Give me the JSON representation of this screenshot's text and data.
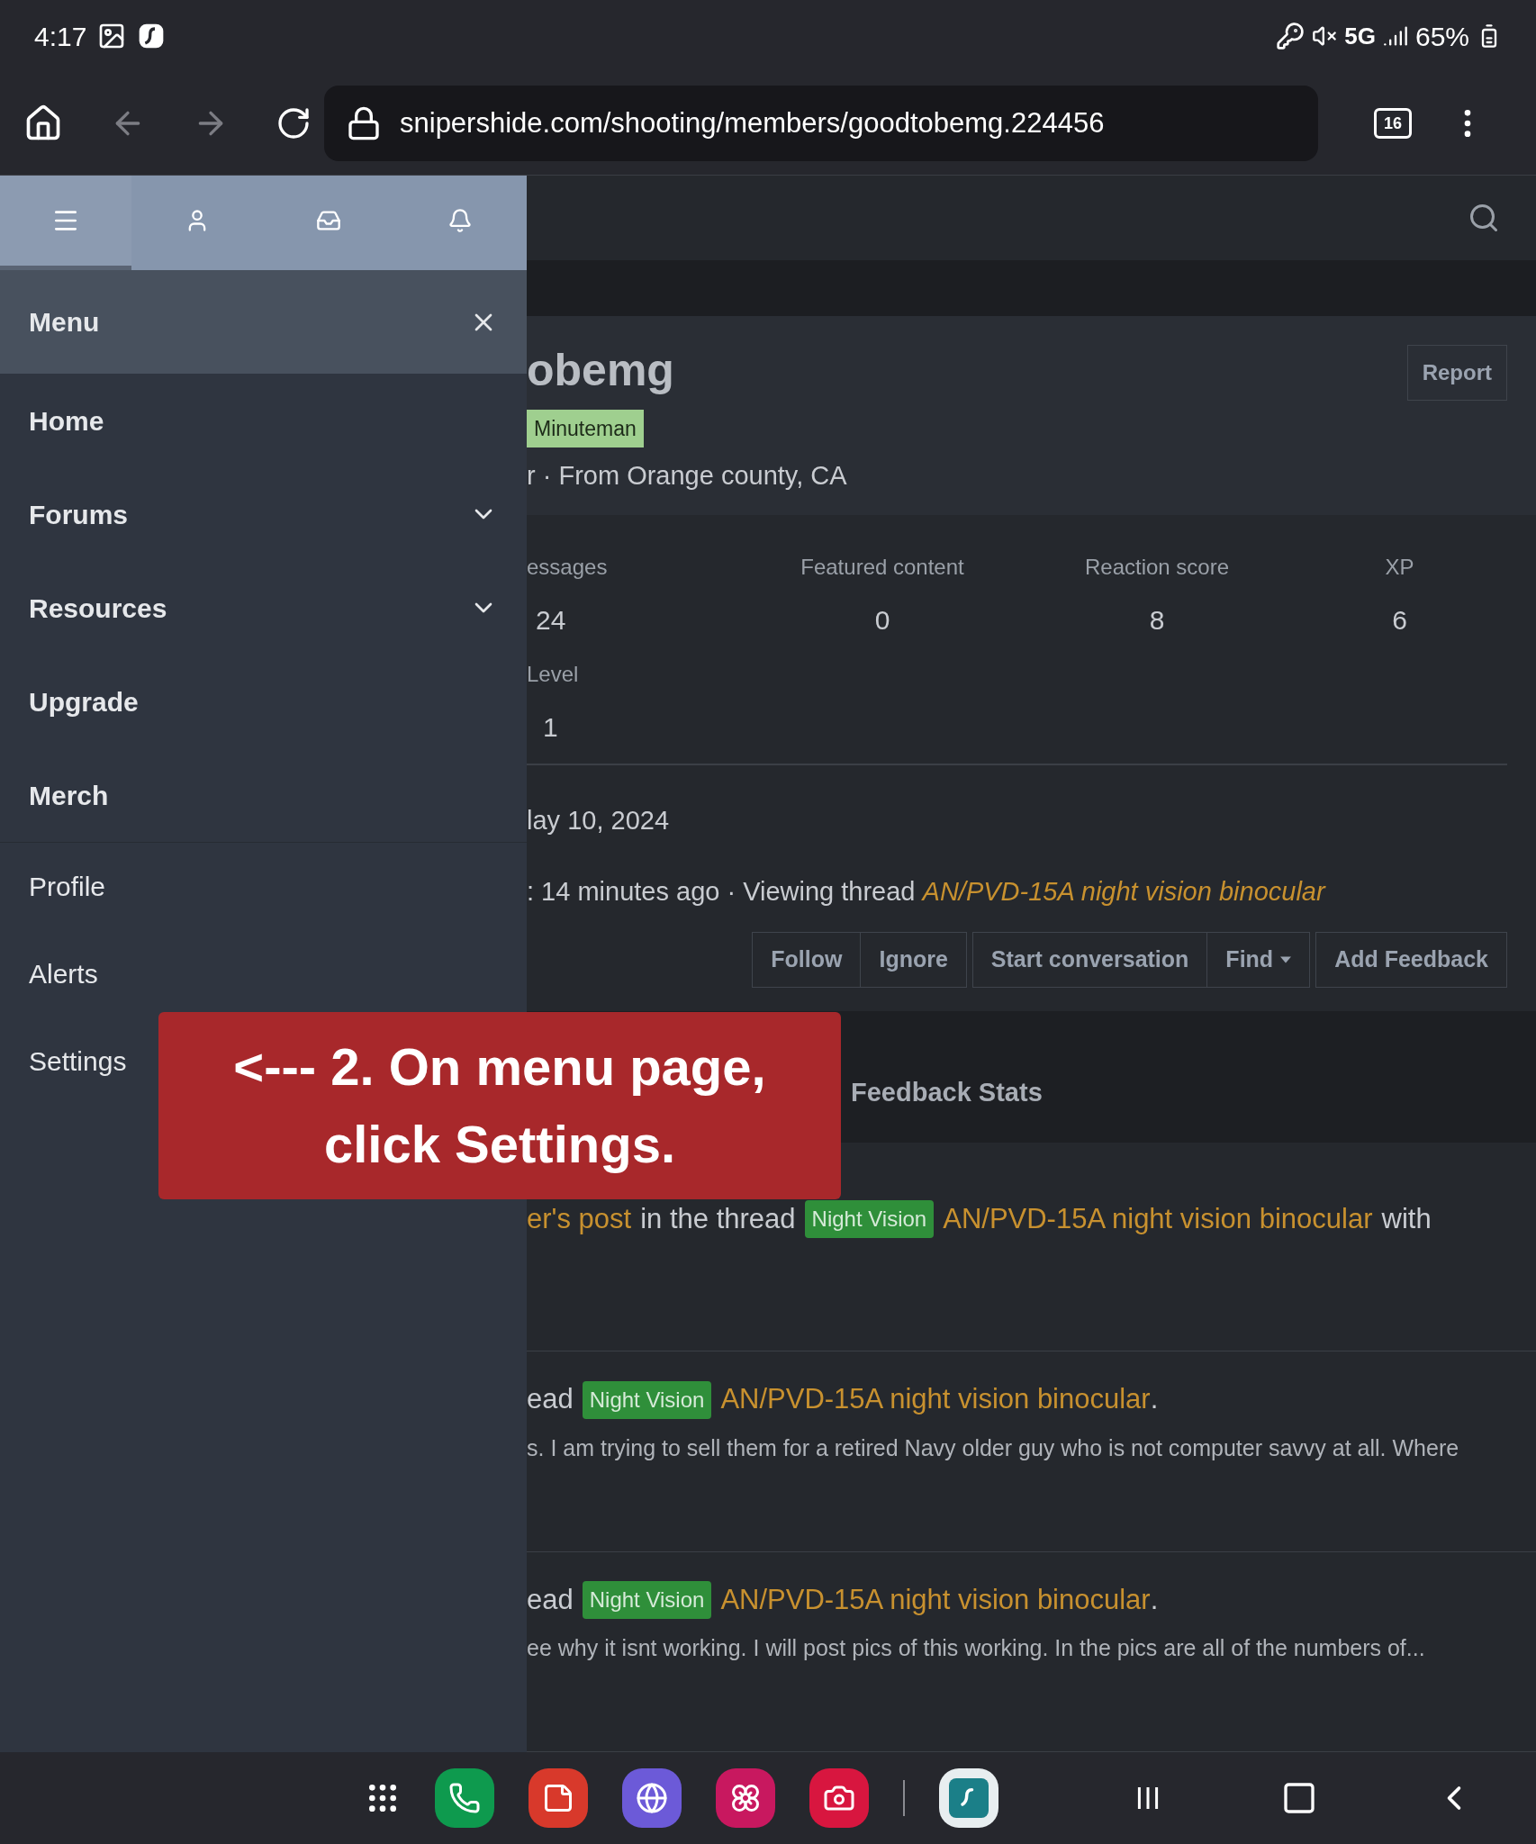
{
  "status_bar": {
    "time": "4:17",
    "network": "5G",
    "battery": "65%"
  },
  "browser": {
    "url": "snipershide.com/shooting/members/goodtobemg.224456",
    "tab_count": "16"
  },
  "drawer": {
    "tabs": [
      {
        "kind": "menu",
        "selected": true
      },
      {
        "kind": "account",
        "selected": false
      },
      {
        "kind": "inbox",
        "selected": false
      },
      {
        "kind": "alerts",
        "selected": false
      }
    ],
    "title": "Menu",
    "items": [
      {
        "label": "Home",
        "kind": "primary",
        "expandable": false
      },
      {
        "label": "Forums",
        "kind": "primary",
        "expandable": true
      },
      {
        "label": "Resources",
        "kind": "primary",
        "expandable": true
      },
      {
        "label": "Upgrade",
        "kind": "primary",
        "expandable": false
      },
      {
        "label": "Merch",
        "kind": "primary",
        "expandable": false
      },
      {
        "label": "Profile",
        "kind": "secondary",
        "expandable": false
      },
      {
        "label": "Alerts",
        "kind": "secondary",
        "expandable": false
      },
      {
        "label": "Settings",
        "kind": "secondary",
        "expandable": false
      }
    ]
  },
  "profile": {
    "name": "obemg",
    "badge": "Minuteman",
    "info": "r · From Orange county, CA",
    "report": "Report",
    "stats": [
      {
        "label": "essages",
        "value": "24"
      },
      {
        "label": "Featured content",
        "value": "0"
      },
      {
        "label": "Reaction score",
        "value": "8"
      },
      {
        "label": "XP",
        "value": "6"
      }
    ],
    "level": {
      "label": "Level",
      "value": "1"
    },
    "joined": "lay 10, 2024",
    "last_seen": ": 14 minutes ago · Viewing thread",
    "last_seen_link": "AN/PVD-15A night vision binocular",
    "button_groups": [
      [
        {
          "label": "Follow",
          "caret": false
        },
        {
          "label": "Ignore",
          "caret": false
        }
      ],
      [
        {
          "label": "Start conversation",
          "caret": false
        },
        {
          "label": "Find",
          "caret": true
        }
      ],
      [
        {
          "label": "Add Feedback",
          "caret": false
        }
      ]
    ],
    "tabs": [
      "Feedback Stats"
    ]
  },
  "activity": [
    {
      "lead_link": "er's post",
      "lead": "in the thread",
      "tag": "Night Vision",
      "link": "AN/PVD-15A night vision binocular",
      "tail": "with"
    },
    {
      "lead": "ead",
      "tag": "Night Vision",
      "link": "AN/PVD-15A night vision binocular",
      "tail": ".",
      "snippet": "s. I am trying to sell them for a retired Navy older guy who is not computer savvy at all. Where"
    },
    {
      "lead": "ead",
      "tag": "Night Vision",
      "link": "AN/PVD-15A night vision binocular",
      "tail": ".",
      "snippet": "ee why it isnt working. I will post pics of this working. In the pics are all of the numbers of..."
    }
  ],
  "callout": "<--- 2. On menu page, click Settings.",
  "dock": [
    {
      "kind": "apps"
    },
    {
      "kind": "phone"
    },
    {
      "kind": "notes"
    },
    {
      "kind": "internet"
    },
    {
      "kind": "gallery"
    },
    {
      "kind": "camera"
    },
    {
      "kind": "divider"
    },
    {
      "kind": "vpn"
    }
  ]
}
